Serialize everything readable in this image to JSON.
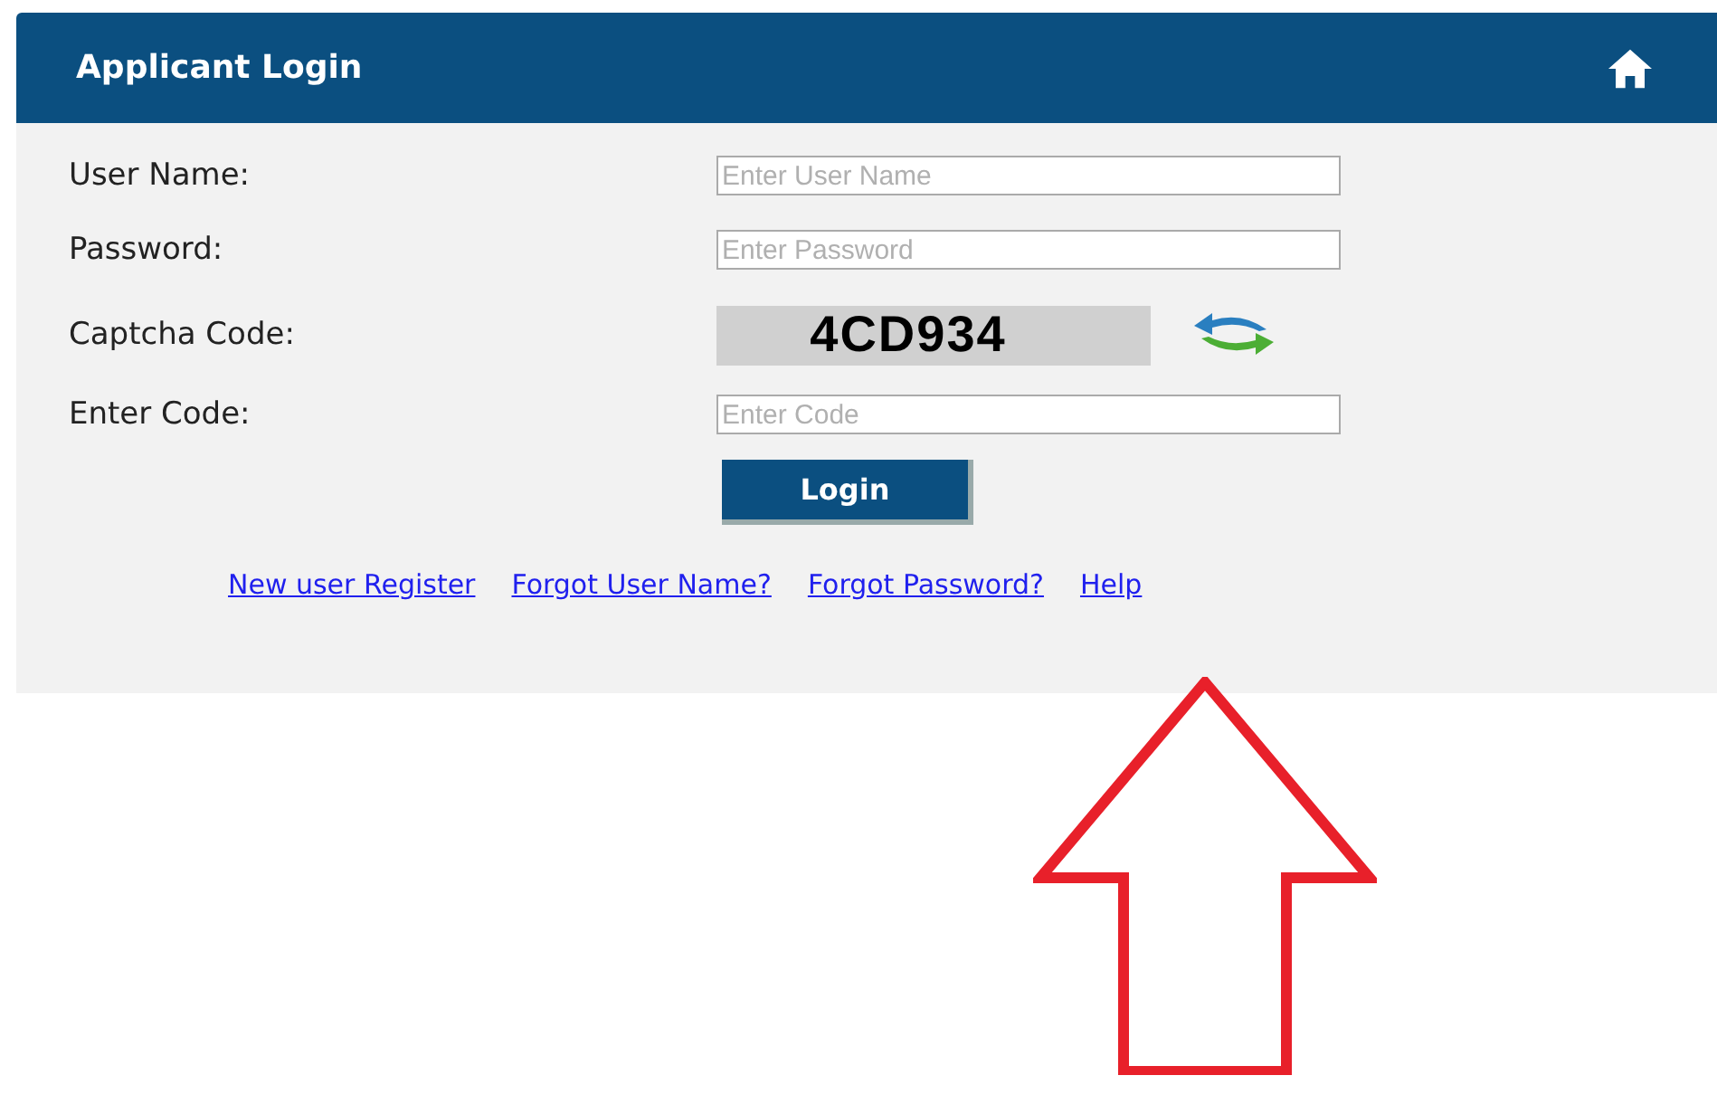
{
  "header": {
    "title": "Applicant Login"
  },
  "fields": [
    {
      "kind": "input",
      "label": "User Name:",
      "placeholder": "Enter User Name"
    },
    {
      "kind": "input",
      "label": "Password:",
      "placeholder": "Enter Password"
    },
    {
      "kind": "captcha",
      "label": "Captcha Code:",
      "code": "4CD934"
    },
    {
      "kind": "input",
      "label": "Enter Code:",
      "placeholder": "Enter Code"
    }
  ],
  "login_button": "Login",
  "links": [
    "New user Register",
    "Forgot User Name?",
    "Forgot Password?",
    "Help"
  ]
}
